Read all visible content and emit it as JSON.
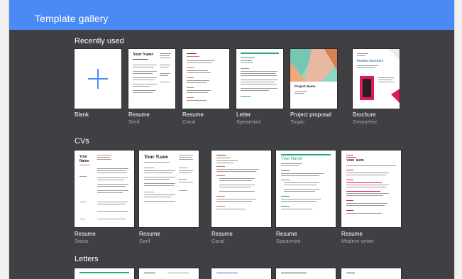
{
  "header": {
    "title": "Template gallery"
  },
  "sections": [
    {
      "title": "Recently used"
    },
    {
      "title": "CVs"
    },
    {
      "title": "Letters"
    }
  ],
  "recent": [
    {
      "name": "Blank",
      "sub": ""
    },
    {
      "name": "Resume",
      "sub": "Serif"
    },
    {
      "name": "Resume",
      "sub": "Coral"
    },
    {
      "name": "Letter",
      "sub": "Spearmint"
    },
    {
      "name": "Project proposal",
      "sub": "Tropic"
    },
    {
      "name": "Brochure",
      "sub": "Geometric"
    }
  ],
  "cvs": [
    {
      "name": "Resume",
      "sub": "Swiss"
    },
    {
      "name": "Resume",
      "sub": "Serif"
    },
    {
      "name": "Resume",
      "sub": "Coral"
    },
    {
      "name": "Resume",
      "sub": "Spearmint"
    },
    {
      "name": "Resume",
      "sub": "Modern writer"
    }
  ],
  "thumb_text": {
    "your_name": "Your Name",
    "project_name": "Project Name",
    "product_brochure": "Product Brochure",
    "swiss_your": "Your",
    "swiss_name": "Name",
    "modern_name": "YOUR NAME"
  },
  "colors": {
    "header": "#4a8af4",
    "background": "#404044",
    "coral": "#e06a55",
    "spearmint": "#2aa57d",
    "brochure_pink": "#e2195a"
  }
}
